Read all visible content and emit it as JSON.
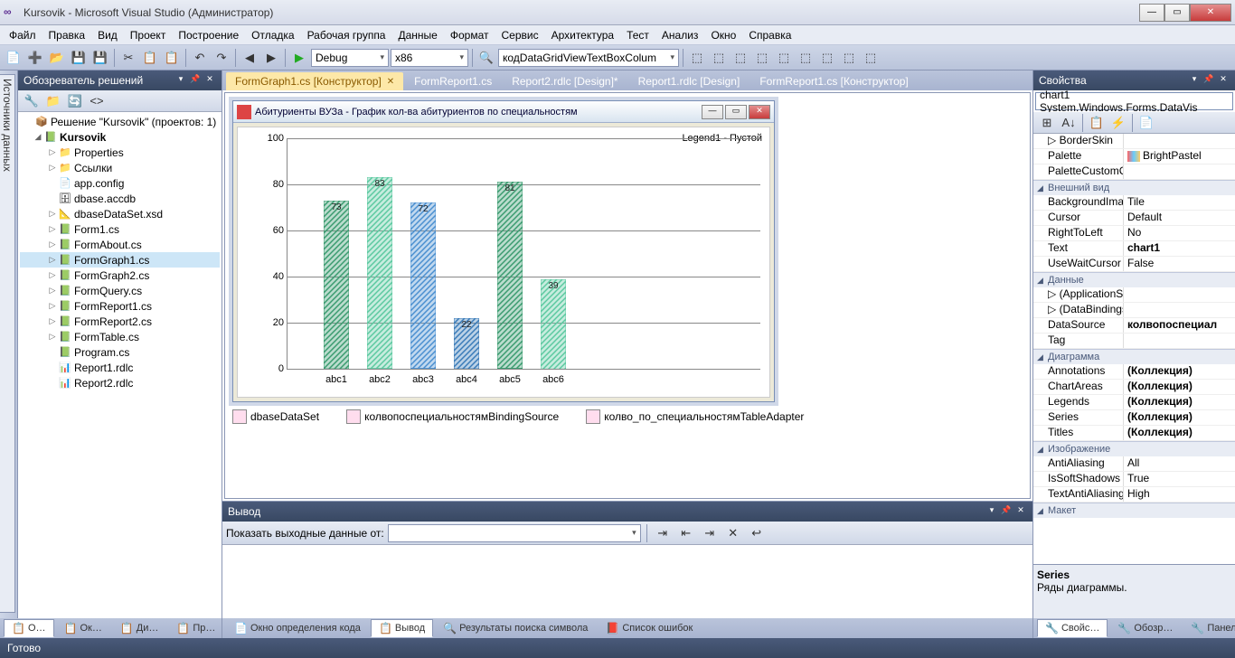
{
  "window": {
    "title": "Kursovik - Microsoft Visual Studio (Администратор)"
  },
  "menu": [
    "Файл",
    "Правка",
    "Вид",
    "Проект",
    "Построение",
    "Отладка",
    "Рабочая группа",
    "Данные",
    "Формат",
    "Сервис",
    "Архитектура",
    "Тест",
    "Анализ",
    "Окно",
    "Справка"
  ],
  "toolbar": {
    "config": "Debug",
    "platform": "x86",
    "search": "кодDataGridViewTextBoxColum"
  },
  "solexp": {
    "title": "Обозреватель решений",
    "solution": "Решение \"Kursovik\"  (проектов: 1)",
    "project": "Kursovik",
    "items": [
      "Properties",
      "Ссылки",
      "app.config",
      "dbase.accdb",
      "dbaseDataSet.xsd",
      "Form1.cs",
      "FormAbout.cs",
      "FormGraph1.cs",
      "FormGraph2.cs",
      "FormQuery.cs",
      "FormReport1.cs",
      "FormReport2.cs",
      "FormTable.cs",
      "Program.cs",
      "Report1.rdlc",
      "Report2.rdlc"
    ]
  },
  "leftdock": {
    "label": "Источники данных"
  },
  "tabs": [
    "FormGraph1.cs [Конструктор]",
    "FormReport1.cs",
    "Report2.rdlc [Design]*",
    "Report1.rdlc [Design]",
    "FormReport1.cs [Конструктор]"
  ],
  "form": {
    "title": "Абитуриенты ВУЗа - График кол-ва абитуриентов по специальностям",
    "legend": "Legend1 - Пустой"
  },
  "chart_data": {
    "type": "bar",
    "categories": [
      "abc1",
      "abc2",
      "abc3",
      "abc4",
      "abc5",
      "abc6"
    ],
    "values": [
      73,
      83,
      72,
      22,
      81,
      39
    ],
    "ylim": [
      0,
      100
    ],
    "yticks": [
      0,
      20,
      40,
      60,
      80,
      100
    ],
    "colors": [
      "#3a9b6f",
      "#5bc9a0",
      "#4a8fd0",
      "#3a7bb8",
      "#3a9b6f",
      "#5bc9a0"
    ]
  },
  "components": [
    "dbaseDataSet",
    "колвопоспециальностямBindingSource",
    "колво_по_специальностямTableAdapter"
  ],
  "output": {
    "title": "Вывод",
    "label": "Показать выходные данные от:"
  },
  "bottomtabs_left": [
    "О…",
    "Ок…",
    "Ди…",
    "Пр…"
  ],
  "bottomtabs_mid": [
    {
      "icon": "📄",
      "label": "Окно определения кода"
    },
    {
      "icon": "📋",
      "label": "Вывод",
      "active": true
    },
    {
      "icon": "🔍",
      "label": "Результаты поиска символа"
    },
    {
      "icon": "📕",
      "label": "Список ошибок"
    }
  ],
  "bottomtabs_right": [
    "Свойс…",
    "Обозр…",
    "Панел…"
  ],
  "props": {
    "title": "Свойства",
    "selector": "chart1  System.Windows.Forms.DataVis",
    "cats": [
      {
        "name": "",
        "rows": [
          {
            "k": "BorderSkin",
            "v": "",
            "exp": true
          },
          {
            "k": "Palette",
            "v": "BrightPastel",
            "icon": true
          },
          {
            "k": "PaletteCustomC",
            "v": ""
          }
        ]
      },
      {
        "name": "Внешний вид",
        "rows": [
          {
            "k": "BackgroundIma",
            "v": "Tile"
          },
          {
            "k": "Cursor",
            "v": "Default"
          },
          {
            "k": "RightToLeft",
            "v": "No"
          },
          {
            "k": "Text",
            "v": "chart1",
            "bold": true
          },
          {
            "k": "UseWaitCursor",
            "v": "False"
          }
        ]
      },
      {
        "name": "Данные",
        "rows": [
          {
            "k": "(ApplicationSett",
            "v": "",
            "exp": true
          },
          {
            "k": "(DataBindings)",
            "v": "",
            "exp": true
          },
          {
            "k": "DataSource",
            "v": "колвопоспециал",
            "bold": true
          },
          {
            "k": "Tag",
            "v": ""
          }
        ]
      },
      {
        "name": "Диаграмма",
        "rows": [
          {
            "k": "Annotations",
            "v": "(Коллекция)",
            "bold": true
          },
          {
            "k": "ChartAreas",
            "v": "(Коллекция)",
            "bold": true
          },
          {
            "k": "Legends",
            "v": "(Коллекция)",
            "bold": true
          },
          {
            "k": "Series",
            "v": "(Коллекция)",
            "bold": true
          },
          {
            "k": "Titles",
            "v": "(Коллекция)",
            "bold": true
          }
        ]
      },
      {
        "name": "Изображение",
        "rows": [
          {
            "k": "AntiAliasing",
            "v": "All"
          },
          {
            "k": "IsSoftShadows",
            "v": "True"
          },
          {
            "k": "TextAntiAliasing",
            "v": "High"
          }
        ]
      },
      {
        "name": "Макет",
        "rows": []
      }
    ],
    "desc_title": "Series",
    "desc_body": "Ряды диаграммы."
  },
  "status": "Готово"
}
